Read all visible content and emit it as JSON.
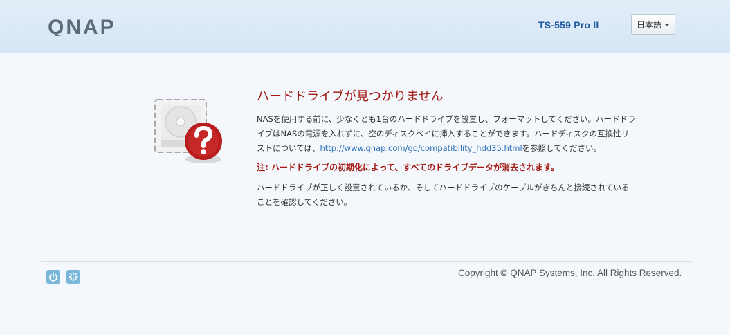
{
  "header": {
    "brand": "QNAP",
    "model": "TS-559 Pro II",
    "language": "日本語"
  },
  "main": {
    "title": "ハードドライブが見つかりません",
    "paragraph1_text": "NASを使用する前に、少なくとも1台のハードドライブを設置し、フォーマットしてください。ハードドライブはNASの電源を入れずに、空のディスクベイに挿入することができます。ハードディスクの互換性リストについては、",
    "compat_link": "http://www.qnap.com/go/compatibility_hdd35.html",
    "paragraph1_suffix": "を参照してください。",
    "warning": "注: ハードドライブの初期化によって、すべてのドライブデータが消去されます。",
    "paragraph2": "ハードドライブが正しく設置されているか、そしてハードドライブのケーブルがきちんと接続されていることを確認してください。"
  },
  "footer": {
    "copyright": "Copyright © QNAP Systems, Inc. All Rights Reserved."
  },
  "icons": {
    "power": "power-icon",
    "restart": "restart-icon",
    "hdd": "hard-drive-icon",
    "question": "question-mark-icon"
  },
  "colors": {
    "accent_red": "#a31a14",
    "link_blue": "#2a6fb5",
    "model_blue": "#1f5a9e",
    "footer_icon_blue": "#7ab8db"
  }
}
